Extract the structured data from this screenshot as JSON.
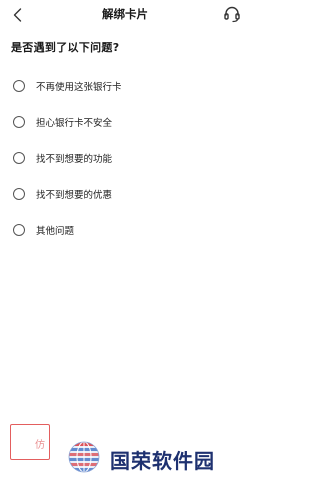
{
  "header": {
    "title": "解绑卡片",
    "back_icon": "chevron-left-icon",
    "service_icon": "headset-icon"
  },
  "question": "是否遇到了以下问题?",
  "options": [
    {
      "label": "不再使用这张银行卡"
    },
    {
      "label": "担心银行卡不安全"
    },
    {
      "label": "找不到想要的功能"
    },
    {
      "label": "找不到想要的优惠"
    },
    {
      "label": "其他问题"
    }
  ],
  "bottom_button": {
    "label": "仿"
  },
  "watermark": {
    "text": "国荣软件园"
  },
  "colors": {
    "accent": "#e35e5e",
    "watermark_text": "#1e3170"
  }
}
